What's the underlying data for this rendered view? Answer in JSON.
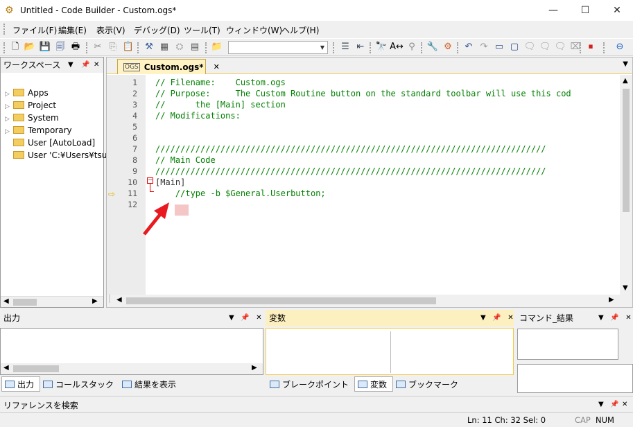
{
  "window": {
    "title": "Untitled - Code Builder - Custom.ogs*",
    "minimize": "—",
    "maximize": "☐",
    "close": "✕"
  },
  "menu": [
    "ファイル(F)",
    "編集(E)",
    "表示(V)",
    "デバッグ(D)",
    "ツール(T)",
    "ウィンドウ(W)",
    "ヘルプ(H)"
  ],
  "workspace": {
    "title": "ワークスペース",
    "items": [
      {
        "label": "Apps",
        "expandable": true
      },
      {
        "label": "Project",
        "expandable": true
      },
      {
        "label": "System",
        "expandable": true
      },
      {
        "label": "Temporary",
        "expandable": true
      },
      {
        "label": "User  [AutoLoad]",
        "expandable": false
      },
      {
        "label": "User 'C:¥Users¥tsuk",
        "expandable": false
      }
    ]
  },
  "editor": {
    "tab_label": "Custom.ogs*",
    "tab_close": "✕",
    "line_numbers": [
      "1",
      "2",
      "3",
      "4",
      "5",
      "6",
      "7",
      "8",
      "9",
      "10",
      "11",
      "12"
    ],
    "lines": [
      "// Filename:    Custom.ogs",
      "// Purpose:     The Custom Routine button on the standard toolbar will use this cod",
      "//      the [Main] section",
      "// Modifications:",
      "",
      "",
      "//////////////////////////////////////////////////////////////////////////////",
      "// Main Code",
      "//////////////////////////////////////////////////////////////////////////////",
      "[Main]",
      "    //type -b $General.Userbutton;",
      ""
    ],
    "current_line": "11"
  },
  "output_panel": {
    "title": "出力",
    "tabs": [
      "出力",
      "コールスタック",
      "結果を表示"
    ]
  },
  "variables_panel": {
    "title": "変数",
    "tabs": [
      "ブレークポイント",
      "変数",
      "ブックマーク"
    ]
  },
  "command_panel": {
    "title": "コマンド_結果"
  },
  "reference_panel": {
    "title": "リファレンスを検索"
  },
  "status": {
    "position": "Ln: 11 Ch: 32 Sel: 0",
    "cap": "CAP",
    "num": "NUM"
  },
  "colors": {
    "accent": "#f6c84b",
    "comment": "#008000",
    "highlight": "#f4c6c6",
    "arrow": "#e8191f"
  },
  "icons": [
    "app-gear-icon",
    "new-file-icon",
    "open-folder-icon",
    "save-icon",
    "save-all-icon",
    "print-icon",
    "cut-icon",
    "copy-icon",
    "paste-icon",
    "build-icon",
    "find-icon",
    "replace-icon",
    "wrench-icon",
    "undo-icon",
    "redo-icon",
    "stop-icon",
    "back-icon"
  ]
}
